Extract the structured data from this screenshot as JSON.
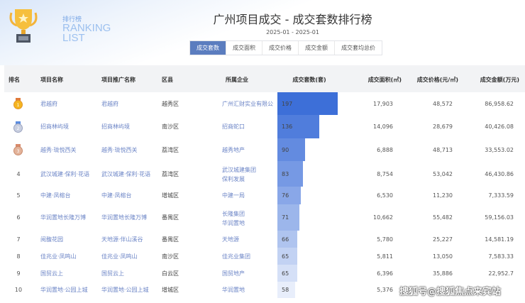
{
  "logo": {
    "cn": "排行榜",
    "en_line1": "RANKING",
    "en_line2": "LIST"
  },
  "title": "广州项目成交 - 成交套数排行榜",
  "date_range": "2025-01 - 2025-01",
  "tabs": [
    {
      "label": "成交套数",
      "active": true
    },
    {
      "label": "成交面积"
    },
    {
      "label": "成交价格"
    },
    {
      "label": "成交金额"
    },
    {
      "label": "成交套均总价"
    }
  ],
  "columns": [
    "排名",
    "项目名称",
    "项目推广名称",
    "区县",
    "所属企业",
    "成交套数(套)",
    "成交面积(㎡)",
    "成交价格(元/㎡)",
    "成交金额(万元)"
  ],
  "rows": [
    {
      "rank": "1",
      "name": "君越府",
      "promo": "君越府",
      "district": "越秀区",
      "company": "广州汇财实业有限公",
      "units": 197,
      "area": "17,903",
      "price": "48,572",
      "amount": "86,958.62"
    },
    {
      "rank": "2",
      "name": "招商林屿境",
      "promo": "招商林屿境",
      "district": "南沙区",
      "company": "招商蛇口",
      "units": 136,
      "area": "14,096",
      "price": "28,679",
      "amount": "40,426.08"
    },
    {
      "rank": "3",
      "name": "越秀·珑悦西关",
      "promo": "越秀·珑悦西关",
      "district": "荔湾区",
      "company": "越秀地产",
      "units": 90,
      "area": "6,888",
      "price": "48,713",
      "amount": "33,553.02"
    },
    {
      "rank": "4",
      "name": "武汉城建·保利·花语",
      "promo": "武汉城建·保利·花语",
      "district": "荔湾区",
      "company": "武汉城建集团",
      "company2": "保利发展",
      "units": 83,
      "area": "8,754",
      "price": "53,042",
      "amount": "46,430.86"
    },
    {
      "rank": "5",
      "name": "中建·凤榕台",
      "promo": "中建·凤榕台",
      "district": "增城区",
      "company": "中建一局",
      "units": 76,
      "area": "6,530",
      "price": "11,230",
      "amount": "7,333.59"
    },
    {
      "rank": "6",
      "name": "华润置地长隆万博",
      "promo": "华润置地长隆万博",
      "district": "番禺区",
      "company": "长隆集团",
      "company2": "华润置地",
      "units": 71,
      "area": "10,662",
      "price": "55,482",
      "amount": "59,156.03"
    },
    {
      "rank": "7",
      "name": "阅馥花园",
      "promo": "天地源·伴山溪谷",
      "district": "番禺区",
      "company": "天地源",
      "units": 66,
      "area": "5,780",
      "price": "25,227",
      "amount": "14,581.19"
    },
    {
      "rank": "8",
      "name": "佳兆业·凤鸣山",
      "promo": "佳兆业·凤鸣山",
      "district": "南沙区",
      "company": "佳兆业集团",
      "units": 65,
      "area": "5,811",
      "price": "13,050",
      "amount": "7,583.33"
    },
    {
      "rank": "9",
      "name": "国贸云上",
      "promo": "国贸云上",
      "district": "白云区",
      "company": "国贸地产",
      "units": 65,
      "area": "6,396",
      "price": "35,886",
      "amount": "22,952.7"
    },
    {
      "rank": "10",
      "name": "华润置地·公园上城",
      "promo": "华润置地·公园上城",
      "district": "增城区",
      "company": "华润置地",
      "units": 58,
      "area": "5,376",
      "price": "",
      "amount": ""
    }
  ],
  "watermark": "搜狐号@搜狐焦点来宾站",
  "colors": {
    "accent": "#5b7dbf",
    "bar_max": "#3d6fd8",
    "bar_min": "#e8eefb",
    "link": "#6b84c6"
  }
}
